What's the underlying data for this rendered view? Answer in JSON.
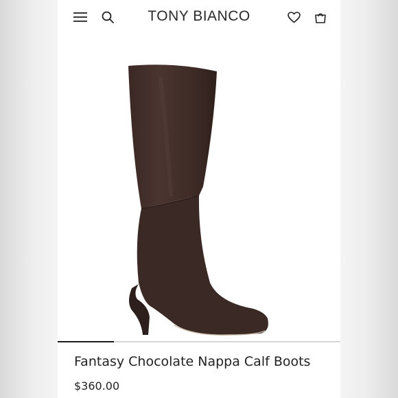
{
  "header": {
    "brand": "TONY BIANCO",
    "icons": [
      "menu-icon",
      "search-icon",
      "heart-icon",
      "shopping-bag-icon"
    ]
  },
  "product": {
    "name": "Fantasy Chocolate Nappa Calf Boots",
    "price": "$360.00",
    "image_color": "#3e2b26"
  },
  "gallery": {
    "progress": 0.2
  },
  "colors": {
    "text": "#222222",
    "progress_fill": "#1a1a1a",
    "progress_track": "#d6d6d6"
  }
}
